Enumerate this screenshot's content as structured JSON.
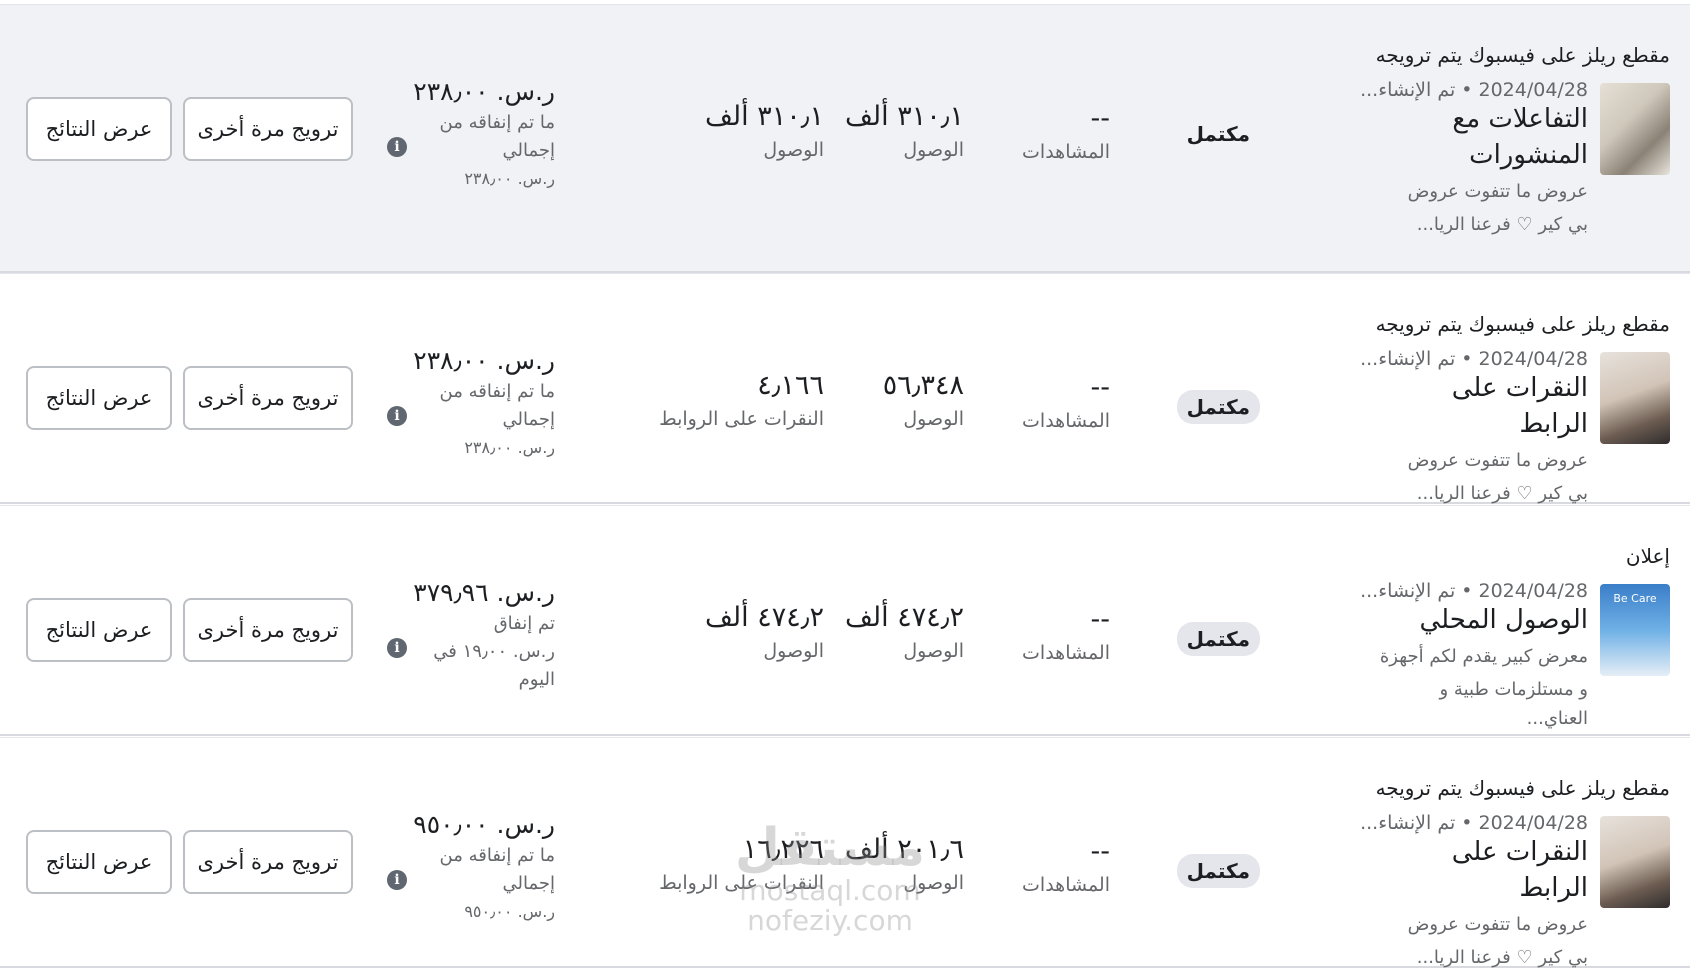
{
  "rows": [
    {
      "ad_type": "مقطع ريلز على فيسبوك يتم ترويجه",
      "date": "2024/04/28",
      "created": "تم الإنشاء...",
      "goal": "التفاعلات مع المنشورات",
      "desc_line1": "عروض ما تتفوت عروض",
      "desc_line2": "بي كير ♡ فرعنا الريا...",
      "thumb_icon": "shelves-photo-thumbnail",
      "status": "مكتمل",
      "views_value": "--",
      "views_label": "المشاهدات",
      "reach_value": "٣١٠٫١ ألف",
      "reach_label": "الوصول",
      "third_value": "٣١٠٫١ ألف",
      "third_label": "الوصول",
      "spend_amount": "ر.س. ٢٣٨٫٠٠",
      "spend_sub1": "ما تم إنفاقه من",
      "spend_sub2": "إجمالي",
      "spend_sub3": "ر.س. ٢٣٨٫٠٠",
      "boost_label": "ترويج مرة أخرى",
      "results_label": "عرض النتائج"
    },
    {
      "ad_type": "مقطع ريلز على فيسبوك يتم ترويجه",
      "date": "2024/04/28",
      "created": "تم الإنشاء...",
      "goal": "النقرات على الرابط",
      "desc_line1": "عروض ما تتفوت عروض",
      "desc_line2": "بي كير ♡ فرعنا الريا...",
      "thumb_icon": "person-photo-thumbnail",
      "status": "مكتمل",
      "views_value": "--",
      "views_label": "المشاهدات",
      "reach_value": "٥٦٫٣٤٨",
      "reach_label": "الوصول",
      "third_value": "٤٫١٦٦",
      "third_label": "النقرات على الروابط",
      "spend_amount": "ر.س. ٢٣٨٫٠٠",
      "spend_sub1": "ما تم إنفاقه من",
      "spend_sub2": "إجمالي",
      "spend_sub3": "ر.س. ٢٣٨٫٠٠",
      "boost_label": "ترويج مرة أخرى",
      "results_label": "عرض النتائج"
    },
    {
      "ad_type": "إعلان",
      "date": "2024/04/28",
      "created": "تم الإنشاء...",
      "goal": "الوصول المحلي",
      "desc_line1": "معرض كبير يقدم لكم أجهزة",
      "desc_line2": "و مستلزمات طبية و العناي...",
      "thumb_icon": "poster-thumbnail",
      "thumb_text": "Be Care",
      "status": "مكتمل",
      "views_value": "--",
      "views_label": "المشاهدات",
      "reach_value": "٤٧٤٫٢ ألف",
      "reach_label": "الوصول",
      "third_value": "٤٧٤٫٢ ألف",
      "third_label": "الوصول",
      "spend_amount": "ر.س. ٣٧٩٫٩٦",
      "spend_sub1": "تم إنفاق",
      "spend_sub2": "ر.س. ١٩٫٠٠ في",
      "spend_sub3": "اليوم",
      "boost_label": "ترويج مرة أخرى",
      "results_label": "عرض النتائج"
    },
    {
      "ad_type": "مقطع ريلز على فيسبوك يتم ترويجه",
      "date": "2024/04/28",
      "created": "تم الإنشاء...",
      "goal": "النقرات على الرابط",
      "desc_line1": "عروض ما تتفوت عروض",
      "desc_line2": "بي كير ♡ فرعنا الريا...",
      "thumb_icon": "person-photo-thumbnail",
      "status": "مكتمل",
      "views_value": "--",
      "views_label": "المشاهدات",
      "reach_value": "٢٠١٫٦ ألف",
      "reach_label": "الوصول",
      "third_value": "١٦٫٢٢٦",
      "third_label": "النقرات على الروابط",
      "spend_amount": "ر.س. ٩٥٠٫٠٠",
      "spend_sub1": "ما تم إنفاقه من",
      "spend_sub2": "إجمالي",
      "spend_sub3": "ر.س. ٩٥٠٫٠٠",
      "boost_label": "ترويج مرة أخرى",
      "results_label": "عرض النتائج"
    }
  ],
  "info_icon_glyph": "i",
  "watermark": {
    "line1": "مستقل",
    "line2": "mostaql.com",
    "line3": "nofeziy.com"
  },
  "colors": {
    "highlight_row_bg": "#f0f2f5",
    "border": "#bcc0c4",
    "secondary_text": "#65676b",
    "status_pill_bg": "#e4e6eb"
  }
}
